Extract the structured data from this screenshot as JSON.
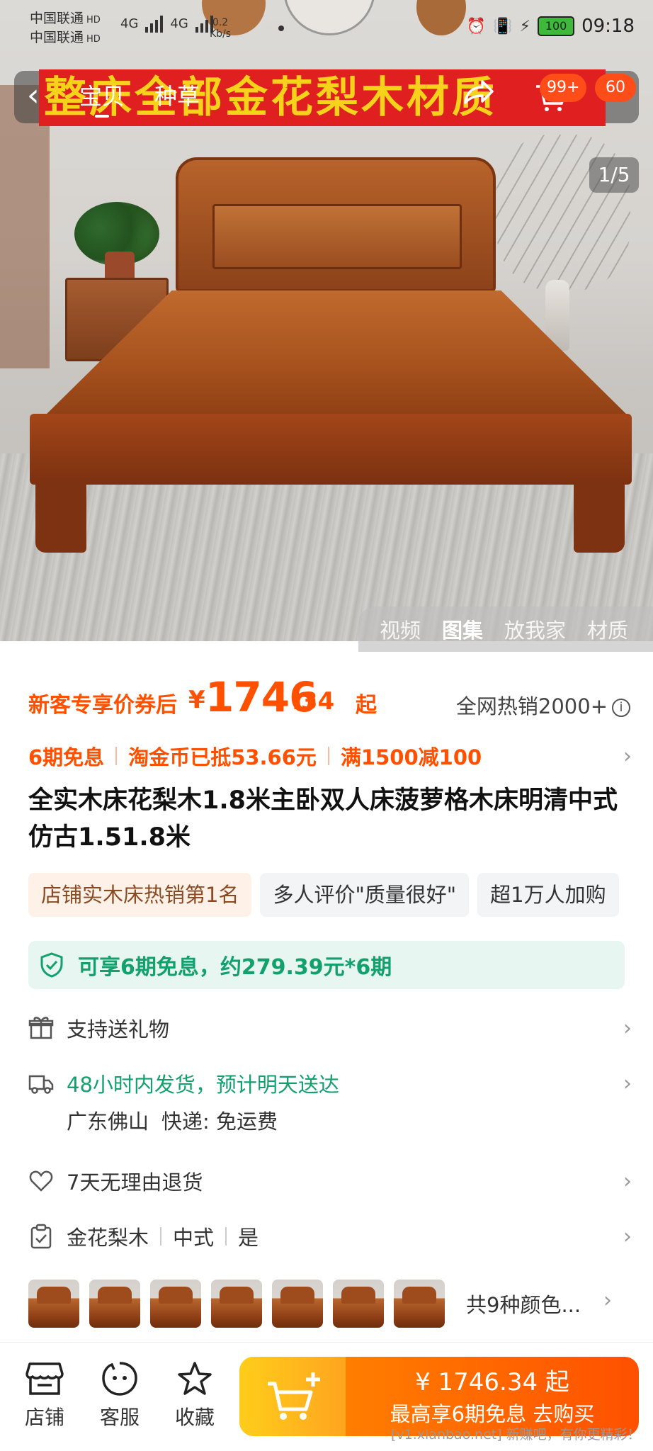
{
  "status_bar": {
    "carrier1": "中国联通",
    "carrier2": "中国联通",
    "hd": "HD",
    "net1": "4G",
    "net2": "4G",
    "speed_value": "0.2",
    "speed_unit": "Kb/s",
    "battery": "100",
    "time": "09:18"
  },
  "nav": {
    "tabs": [
      "宝贝",
      "种草"
    ],
    "banner_text": "整床全部金花梨木材质",
    "message_badge": "99+",
    "cart_badge": "60",
    "image_counter": "1/5"
  },
  "media_tabs": [
    "视频",
    "图集",
    "放我家",
    "材质"
  ],
  "price": {
    "label": "新客专享价券后",
    "currency": "¥",
    "integer": "1746",
    "decimal": ".34",
    "suffix": "起",
    "hot_sale": "全网热销2000+"
  },
  "promos": [
    "6期免息",
    "淘金币已抵53.66元",
    "满1500减100"
  ],
  "title": "全实木床花梨木1.8米主卧双人床菠萝格木床明清中式仿古1.51.8米",
  "tags": [
    "店铺实木床热销第1名",
    "多人评价\"质量很好\"",
    "超1万人加购"
  ],
  "installment": "可享6期免息，约279.39元*6期",
  "service_rows": {
    "gift": "支持送礼物",
    "shipping": "48小时内发货，预计明天送达",
    "origin": "广东佛山",
    "express": "快递: 免运费",
    "returns": "7天无理由退货",
    "attrs": [
      "金花梨木",
      "中式",
      "是"
    ]
  },
  "colors": {
    "count_label": "共9种颜色..."
  },
  "bottom_bar": {
    "shop": "店铺",
    "service": "客服",
    "favorite": "收藏",
    "buy_price": "¥ 1746.34 起",
    "buy_sub": "最高享6期免息  去购买"
  },
  "watermark": "[v1.xianbao.net] 新赚吧，有你更精彩！",
  "theme": {
    "accent": "#ff5000",
    "green": "#13a06f"
  }
}
